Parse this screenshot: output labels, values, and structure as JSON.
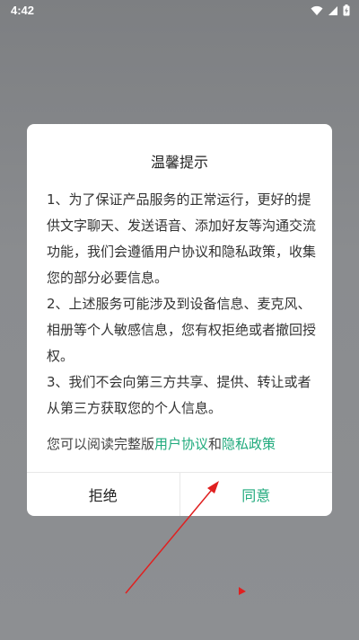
{
  "status_bar": {
    "time": "4:42",
    "icons": [
      "wifi-icon",
      "signal-icon",
      "battery-charging-icon"
    ]
  },
  "dialog": {
    "title": "温馨提示",
    "paragraphs": [
      "1、为了保证产品服务的正常运行，更好的提供文字聊天、发送语音、添加好友等沟通交流功能，我们会遵循用户协议和隐私政策，收集您的部分必要信息。",
      "2、上述服务可能涉及到设备信息、麦克风、相册等个人敏感信息，您有权拒绝或者撤回授权。",
      "3、我们不会向第三方共享、提供、转让或者从第三方获取您的个人信息。"
    ],
    "read_hint_prefix": "您可以阅读完整版",
    "user_agreement_link": "用户协议",
    "conjunction": "和",
    "privacy_policy_link": "隐私政策",
    "reject_label": "拒绝",
    "agree_label": "同意"
  },
  "colors": {
    "accent": "#1faa7c",
    "annotation_arrow": "#e02020",
    "overlay": "#868889"
  }
}
